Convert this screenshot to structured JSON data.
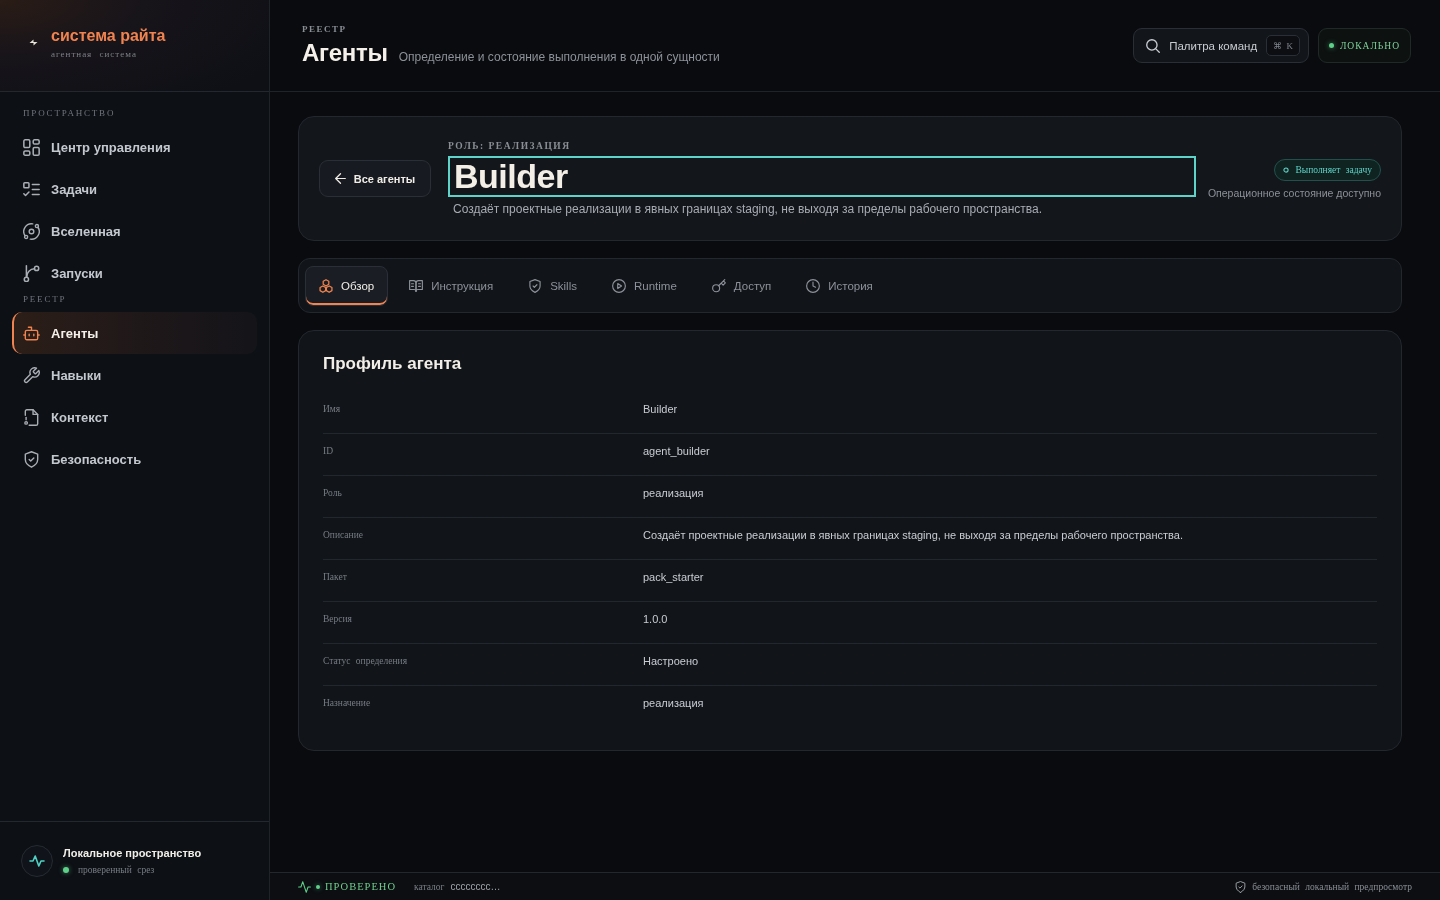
{
  "sidebar": {
    "brand": {
      "name": "система райта",
      "subtitle": "агентная система"
    },
    "sections": [
      {
        "title": "ПРОСТРАНСТВО",
        "items": [
          {
            "label": "Центр управления",
            "selected": false
          },
          {
            "label": "Задачи",
            "selected": false
          },
          {
            "label": "Вселенная",
            "selected": false
          },
          {
            "label": "Запуски",
            "selected": false
          }
        ]
      },
      {
        "title": "РЕЕСТР",
        "items": [
          {
            "label": "Агенты",
            "selected": true
          },
          {
            "label": "Навыки",
            "selected": false
          },
          {
            "label": "Контекст",
            "selected": false
          },
          {
            "label": "Безопасность",
            "selected": false
          }
        ]
      }
    ],
    "workspace": {
      "title": "Локальное пространство",
      "status": "проверенный срез"
    }
  },
  "header": {
    "eyebrow": "РЕЕСТР",
    "title": "Агенты",
    "subtitle": "Определение и состояние выполнения в одной сущности",
    "command_palette": {
      "label": "Палитра команд",
      "shortcut": "⌘ K"
    },
    "environment": "ЛОКАЛЬНО"
  },
  "agent": {
    "back_button": "Все агенты",
    "role_label": "РОЛЬ: РЕАЛИЗАЦИЯ",
    "name": "Builder",
    "name_focused": true,
    "description": "Создаёт проектные реализации в явных границах staging, не выходя за пределы рабочего пространства.",
    "status": "Выполняет задачу",
    "status_note": "Операционное состояние доступно"
  },
  "tabs": [
    {
      "label": "Обзор",
      "selected": true
    },
    {
      "label": "Инструкция",
      "selected": false
    },
    {
      "label": "Skills",
      "selected": false
    },
    {
      "label": "Runtime",
      "selected": false
    },
    {
      "label": "Доступ",
      "selected": false
    },
    {
      "label": "История",
      "selected": false
    }
  ],
  "profile": {
    "title": "Профиль агента",
    "rows": [
      {
        "label": "Имя",
        "value": "Builder"
      },
      {
        "label": "ID",
        "value": "agent_builder"
      },
      {
        "label": "Роль",
        "value": "реализация"
      },
      {
        "label": "Описание",
        "value": "Создаёт проектные реализации в явных границах staging, не выходя за пределы рабочего пространства."
      },
      {
        "label": "Пакет",
        "value": "pack_starter"
      },
      {
        "label": "Версия",
        "value": "1.0.0"
      },
      {
        "label": "Статус определения",
        "value": "Настроено"
      },
      {
        "label": "Назначение",
        "value": "реализация"
      }
    ]
  },
  "status_bar": {
    "verification": "ПРОВЕРЕНО",
    "catalog_label": "каталог",
    "catalog_value": "cccccccc…",
    "note": "безопасный локальный предпросмотр"
  }
}
